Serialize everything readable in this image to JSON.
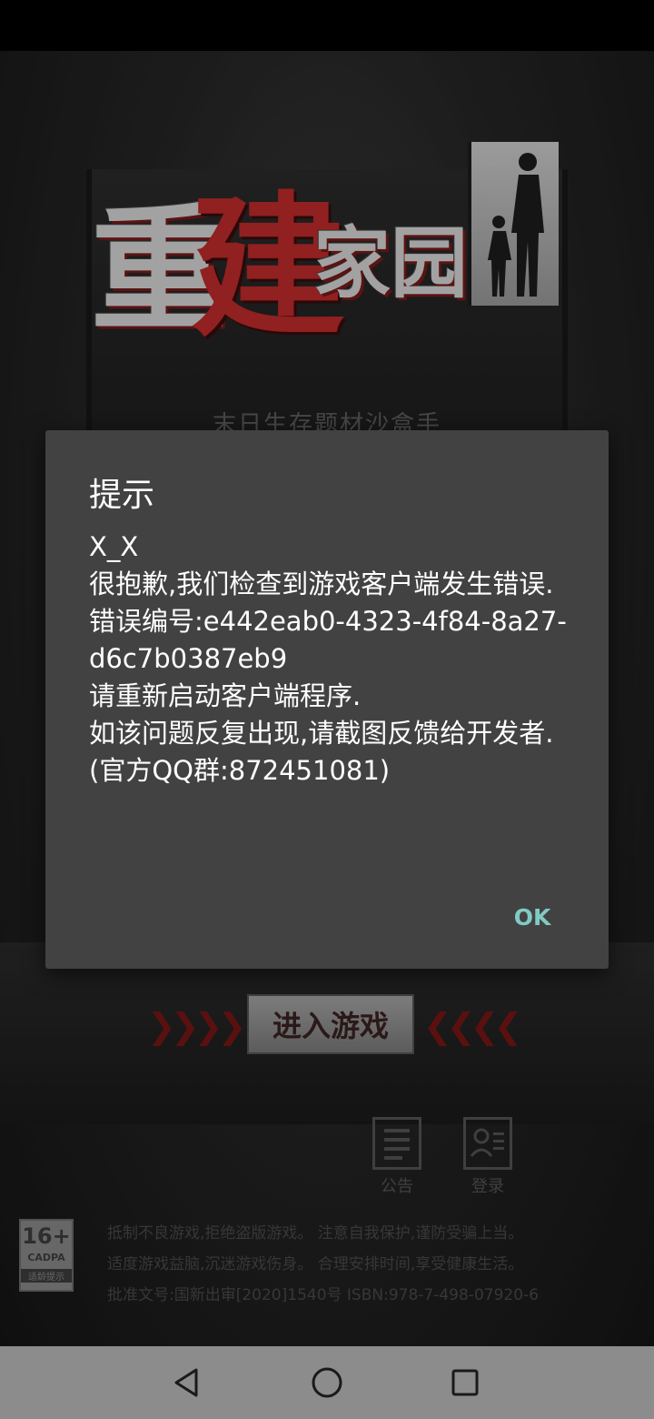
{
  "background": {
    "logo_chars": [
      "重",
      "建",
      "家",
      "园"
    ],
    "subtitle": "末日生存题材沙盒手游",
    "enter_button": "进入游戏",
    "arrows_left": "❯❯❯❯",
    "arrows_right": "❮❮❮❮",
    "menu": {
      "notice": "公告",
      "login": "登录"
    },
    "age_badge": {
      "age": "16+",
      "org": "CADPA",
      "tip": "适龄提示"
    },
    "health_lines": [
      "抵制不良游戏,拒绝盗版游戏。 注意自我保护,谨防受骗上当。",
      "适度游戏益脑,沉迷游戏伤身。 合理安排时间,享受健康生活。",
      "批准文号:国新出审[2020]1540号    ISBN:978-7-498-07920-6"
    ]
  },
  "dialog": {
    "title": "提示",
    "lines": [
      "X_X",
      "很抱歉,我们检查到游戏客户端发生错误.",
      "错误编号:e442eab0-4323-4f84-8a27-d6c7b0387eb9",
      "请重新启动客户端程序.",
      "如该问题反复出现,请截图反馈给开发者.",
      "(官方QQ群:872451081)"
    ],
    "ok_label": "OK",
    "ok_color": "#80cbc4",
    "background_color": "#424242"
  },
  "navigation": {
    "back_icon": "triangle-back-icon",
    "home_icon": "circle-home-icon",
    "recents_icon": "square-recents-icon"
  }
}
